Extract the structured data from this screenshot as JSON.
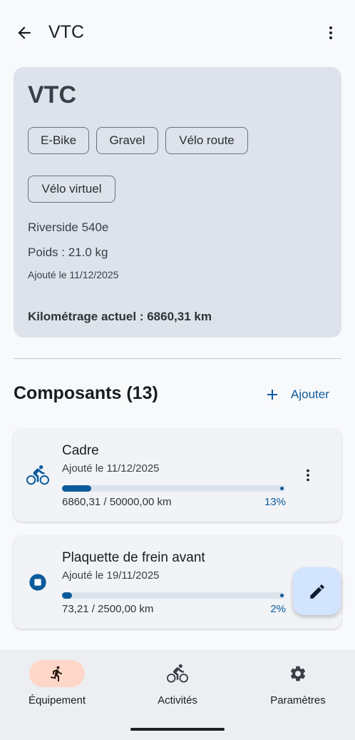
{
  "topbar": {
    "title": "VTC"
  },
  "bike": {
    "name": "VTC",
    "types": [
      "E-Bike",
      "Gravel",
      "Vélo route",
      "Vélo virtuel"
    ],
    "model": "Riverside 540e",
    "weight": "Poids : 21.0 kg",
    "added": "Ajouté le 11/12/2025",
    "mileage": "Kilométrage actuel : 6860,31 km"
  },
  "components": {
    "title": "Composants (13)",
    "add_label": "Ajouter",
    "items": [
      {
        "name": "Cadre",
        "added": "Ajouté le 11/12/2025",
        "km": "6860,31 / 50000,00 km",
        "percent": "13%",
        "progress": 0.13,
        "icon": "bicycle-icon"
      },
      {
        "name": "Plaquette de frein avant",
        "added": "Ajouté le 19/11/2025",
        "km": "73,21 / 2500,00 km",
        "percent": "2%",
        "progress": 0.02,
        "icon": "stop-circle-icon"
      }
    ]
  },
  "nav": {
    "items": [
      {
        "label": "Équipement",
        "icon": "person-running-icon",
        "active": true
      },
      {
        "label": "Activités",
        "icon": "bicycle-icon",
        "active": false
      },
      {
        "label": "Paramètres",
        "icon": "gear-icon",
        "active": false
      }
    ]
  },
  "colors": {
    "primary": "#0b5b9c",
    "card_bg": "#dde2eb",
    "fab_bg": "#d3e4ff",
    "nav_active": "#ffd7c9"
  }
}
